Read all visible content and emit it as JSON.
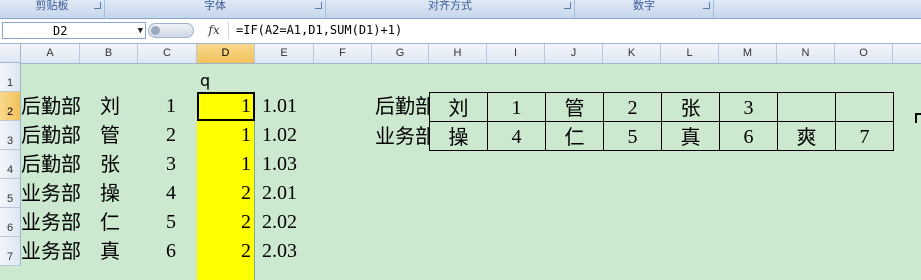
{
  "ribbon": {
    "groups": [
      "剪贴板",
      "字体",
      "对齐方式",
      "数字"
    ]
  },
  "formula_bar": {
    "name_box": "D2",
    "fx_label": "fx",
    "formula": "=IF(A2=A1,D1,SUM(D1)+1)"
  },
  "columns": [
    "A",
    "B",
    "C",
    "D",
    "E",
    "F",
    "G",
    "H",
    "I",
    "J",
    "K",
    "L",
    "M",
    "N",
    "O"
  ],
  "rows": [
    "1",
    "2",
    "3",
    "4",
    "5",
    "6",
    "7"
  ],
  "sheet": {
    "d1": "q",
    "data_rows": [
      {
        "a": "后勤部",
        "b": "刘",
        "c": "1",
        "d": "1",
        "e": "1.01"
      },
      {
        "a": "后勤部",
        "b": "管",
        "c": "2",
        "d": "1",
        "e": "1.02"
      },
      {
        "a": "后勤部",
        "b": "张",
        "c": "3",
        "d": "1",
        "e": "1.03"
      },
      {
        "a": "业务部",
        "b": "操",
        "c": "4",
        "d": "2",
        "e": "2.01"
      },
      {
        "a": "业务部",
        "b": "仁",
        "c": "5",
        "d": "2",
        "e": "2.02"
      },
      {
        "a": "业务部",
        "b": "真",
        "c": "6",
        "d": "2",
        "e": "2.03"
      }
    ]
  },
  "summary_table": {
    "row1_label": "后勤部",
    "row2_label": "业务部",
    "row1": [
      "刘",
      "1",
      "管",
      "2",
      "张",
      "3",
      "",
      ""
    ],
    "row2": [
      "操",
      "4",
      "仁",
      "5",
      "真",
      "6",
      "爽",
      "7"
    ]
  },
  "colors": {
    "sheet_background": "#cce8cf",
    "highlight": "#ffff00"
  }
}
